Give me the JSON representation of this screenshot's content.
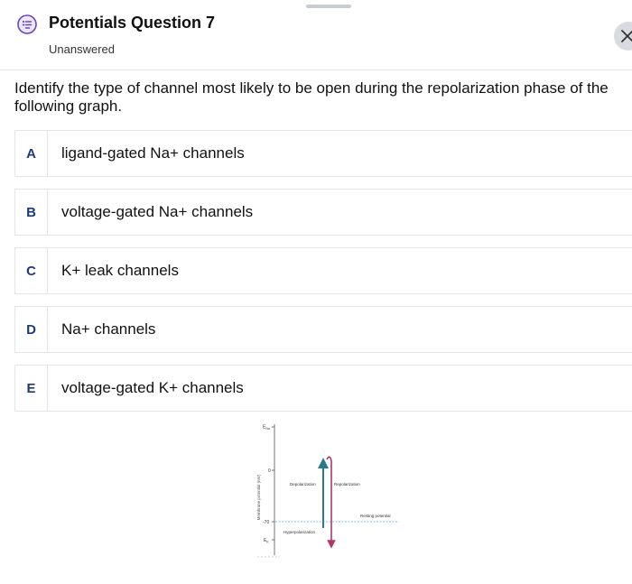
{
  "header": {
    "title": "Potentials Question 7",
    "status": "Unanswered"
  },
  "question": {
    "text": "Identify the type of channel most likely to be open during the repolarization phase of the following graph."
  },
  "options": [
    {
      "letter": "A",
      "text": "ligand-gated Na+ channels"
    },
    {
      "letter": "B",
      "text": "voltage-gated Na+ channels"
    },
    {
      "letter": "C",
      "text": "K+ leak channels"
    },
    {
      "letter": "D",
      "text": "Na+ channels"
    },
    {
      "letter": "E",
      "text": "voltage-gated K+ channels"
    }
  ],
  "graph": {
    "y_axis_label": "Membrane potential (mV)",
    "tick_ena": "E",
    "tick_ena_sub": "Na",
    "tick_zero": "0",
    "tick_minus70": "-70",
    "tick_ek": "E",
    "tick_ek_sub": "K",
    "label_depolarization": "Depolarization",
    "label_repolarization": "Repolarization",
    "label_resting": "Resting potential",
    "label_hyperpolarization": "Hyperpolarization"
  },
  "colors": {
    "option_letter": "#1d3b7a",
    "icon_accent": "#6b46c1",
    "depolarization_arrow": "#2a7a8c",
    "repolarization_arrow": "#b0356a",
    "resting_line": "#5aa9d6"
  }
}
